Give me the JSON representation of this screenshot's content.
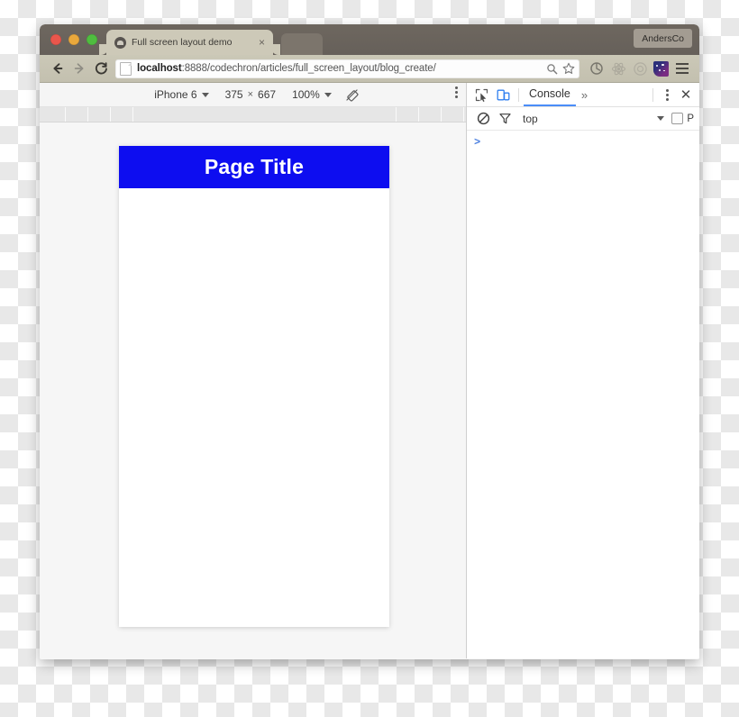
{
  "window": {
    "traffic_lights": [
      "close",
      "minimize",
      "zoom"
    ],
    "profile_label": "AndersCo"
  },
  "tab": {
    "title": "Full screen layout demo",
    "close_label": "×",
    "favicon": "globe-favicon"
  },
  "toolbar": {
    "back_label": "Back",
    "forward_label": "Forward",
    "reload_label": "C",
    "url_host": "localhost",
    "url_rest": ":8888/codechron/articles/full_screen_layout/blog_create/",
    "url_full": "localhost:8888/codechron/articles/full_screen_layout/blog_create/",
    "icons": [
      "search-icon",
      "bookmark-star-icon",
      "sync-refresh-icon",
      "react-devtools-icon",
      "record-circle-icon",
      "extension-icon",
      "chrome-menu-icon"
    ]
  },
  "device_mode": {
    "device_name": "iPhone 6",
    "width": "375",
    "times": "×",
    "height": "667",
    "zoom": "100%",
    "rotate_label": "Rotate",
    "menu_label": "More options",
    "ruler_ticks": [
      28,
      53,
      78,
      103,
      395,
      420,
      445,
      470
    ]
  },
  "page": {
    "header_title": "Page Title",
    "header_color": "#0d0df0",
    "header_text_color": "#ffffff",
    "body_color": "#ffffff"
  },
  "devtools": {
    "inspect_label": "Inspect element",
    "device_toggle_label": "Toggle device toolbar",
    "active_tab": "Console",
    "more_tabs": "»",
    "menu_label": "Customize and control DevTools",
    "close_label": "✕",
    "clear_label": "Clear console",
    "filter_label": "Filter",
    "context": "top",
    "preserve_log": "P",
    "preserve_checked": false,
    "prompt": ">"
  },
  "colors": {
    "titlebar": "#6e675f",
    "toolbar": "#c7c4b3",
    "accent_blue": "#4a8df8",
    "page_blue": "#0d0df0"
  }
}
